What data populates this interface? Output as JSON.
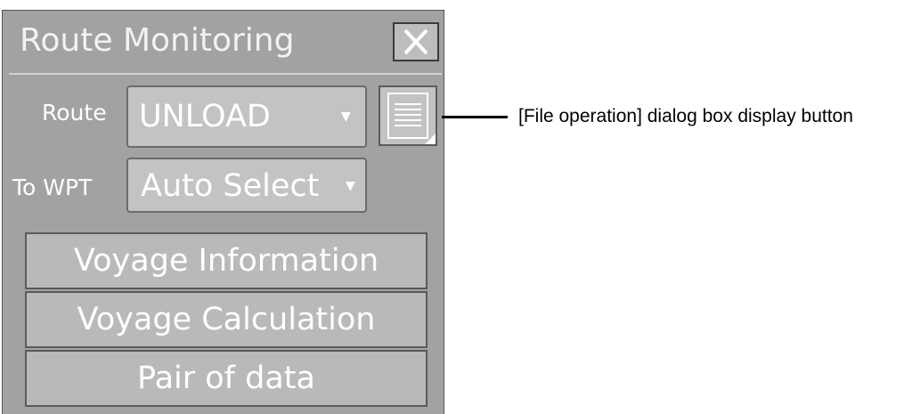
{
  "window": {
    "title": "Route Monitoring",
    "close_icon": "close-icon"
  },
  "route": {
    "label": "Route",
    "value": "UNLOAD",
    "file_button_icon": "file-list-icon"
  },
  "to_wpt": {
    "label": "To WPT",
    "value": "Auto Select"
  },
  "buttons": {
    "voyage_information": "Voyage Information",
    "voyage_calculation": "Voyage Calculation",
    "pair_of_data": "Pair of data"
  },
  "annotation": {
    "text": "[File operation] dialog box display button"
  }
}
